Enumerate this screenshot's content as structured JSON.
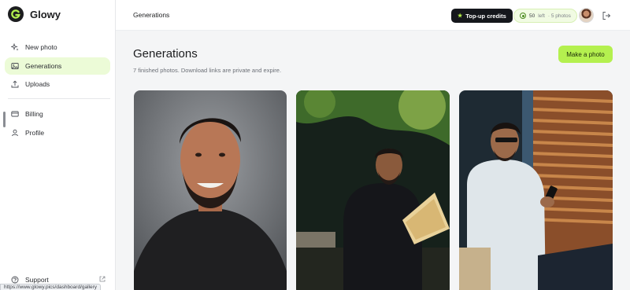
{
  "app": {
    "name": "Glowy"
  },
  "sidebar": {
    "items": [
      {
        "label": "New photo",
        "icon": "sparkle-icon"
      },
      {
        "label": "Generations",
        "icon": "image-icon",
        "active": true
      },
      {
        "label": "Uploads",
        "icon": "upload-icon"
      }
    ],
    "items2": [
      {
        "label": "Billing",
        "icon": "credit-card-icon"
      },
      {
        "label": "Profile",
        "icon": "user-icon"
      }
    ],
    "support": {
      "label": "Support",
      "icon": "external-link-icon"
    }
  },
  "status_bar": {
    "url": "https://www.glowy.pics/dashboard/gallery"
  },
  "header": {
    "title": "Generations",
    "topup_label": "Top-up credits",
    "credits_count": "50",
    "credits_left": "left",
    "credits_photos": "· 5 photos"
  },
  "main": {
    "title": "Generations",
    "subtitle": "7 finished photos. Download links are private and expire.",
    "make_photo_label": "Make a photo"
  },
  "gallery": [
    {
      "alt": "studio-headshot-photo"
    },
    {
      "alt": "garden-reading-photo"
    },
    {
      "alt": "window-phone-photo"
    }
  ],
  "colors": {
    "accent": "#b4f04f",
    "active_nav": "#ecfbd7",
    "dark_button": "#15171c"
  }
}
